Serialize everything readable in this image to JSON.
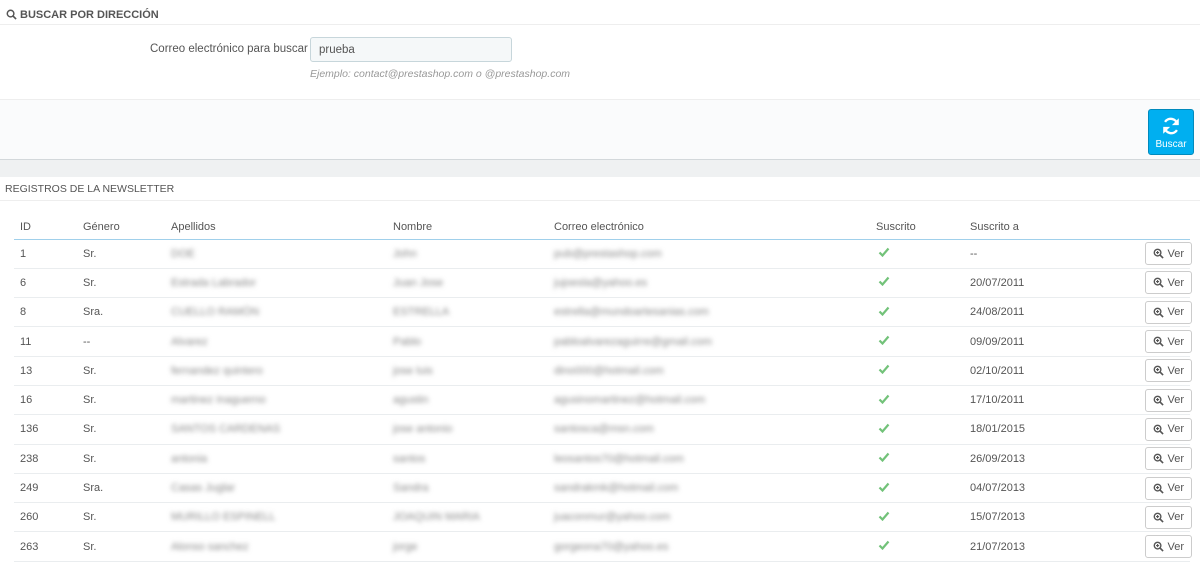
{
  "search_panel": {
    "heading": "BUSCAR POR DIRECCIÓN",
    "field_label": "Correo electrónico para buscar",
    "field_value": "prueba",
    "help_text": "Ejemplo: contact@prestashop.com o @prestashop.com",
    "button_label": "Buscar"
  },
  "list_panel": {
    "heading": "REGISTROS DE LA NEWSLETTER",
    "columns": [
      "ID",
      "Género",
      "Apellidos",
      "Nombre",
      "Correo electrónico",
      "Suscrito",
      "Suscrito a"
    ],
    "view_label": "Ver",
    "rows": [
      {
        "id": "1",
        "gender": "Sr.",
        "lastname": "DOE",
        "firstname": "John",
        "email": "pub@prestashop.com",
        "date": "--"
      },
      {
        "id": "6",
        "gender": "Sr.",
        "lastname": "Estrada Labrador",
        "firstname": "Juan Jose",
        "email": "jujoesla@yahoo.es",
        "date": "20/07/2011"
      },
      {
        "id": "8",
        "gender": "Sra.",
        "lastname": "CUELLO RAMÓN",
        "firstname": "ESTRELLA",
        "email": "estrella@mundoartesanias.com",
        "date": "24/08/2011"
      },
      {
        "id": "11",
        "gender": "--",
        "lastname": "Alvarez",
        "firstname": "Pablo",
        "email": "pabloalvarezaguirre@gmail.com",
        "date": "09/09/2011"
      },
      {
        "id": "13",
        "gender": "Sr.",
        "lastname": "fernandez quintero",
        "firstname": "jose luis",
        "email": "dino000@hotmail.com",
        "date": "02/10/2011"
      },
      {
        "id": "16",
        "gender": "Sr.",
        "lastname": "martinez Inaguerno",
        "firstname": "agustin",
        "email": "agusinomartinez@hotmail.com",
        "date": "17/10/2011"
      },
      {
        "id": "136",
        "gender": "Sr.",
        "lastname": "SANTOS CARDENAS",
        "firstname": "jose antonio",
        "email": "santosca@msn.com",
        "date": "18/01/2015"
      },
      {
        "id": "238",
        "gender": "Sr.",
        "lastname": "antonia",
        "firstname": "santos",
        "email": "leosantos70@hotmail.com",
        "date": "26/09/2013"
      },
      {
        "id": "249",
        "gender": "Sra.",
        "lastname": "Casas Juglar",
        "firstname": "Sandra",
        "email": "sandrakmk@hotmail.com",
        "date": "04/07/2013"
      },
      {
        "id": "260",
        "gender": "Sr.",
        "lastname": "MURILLO ESPINELL",
        "firstname": "JOAQUIN MARIA",
        "email": "juaconmur@yahoo.com",
        "date": "15/07/2013"
      },
      {
        "id": "263",
        "gender": "Sr.",
        "lastname": "Alonso sanchez",
        "firstname": "jorge",
        "email": "gorgeona70@yahoo.es",
        "date": "21/07/2013"
      }
    ]
  },
  "colors": {
    "accent": "#00aff0",
    "check": "#72c279"
  }
}
